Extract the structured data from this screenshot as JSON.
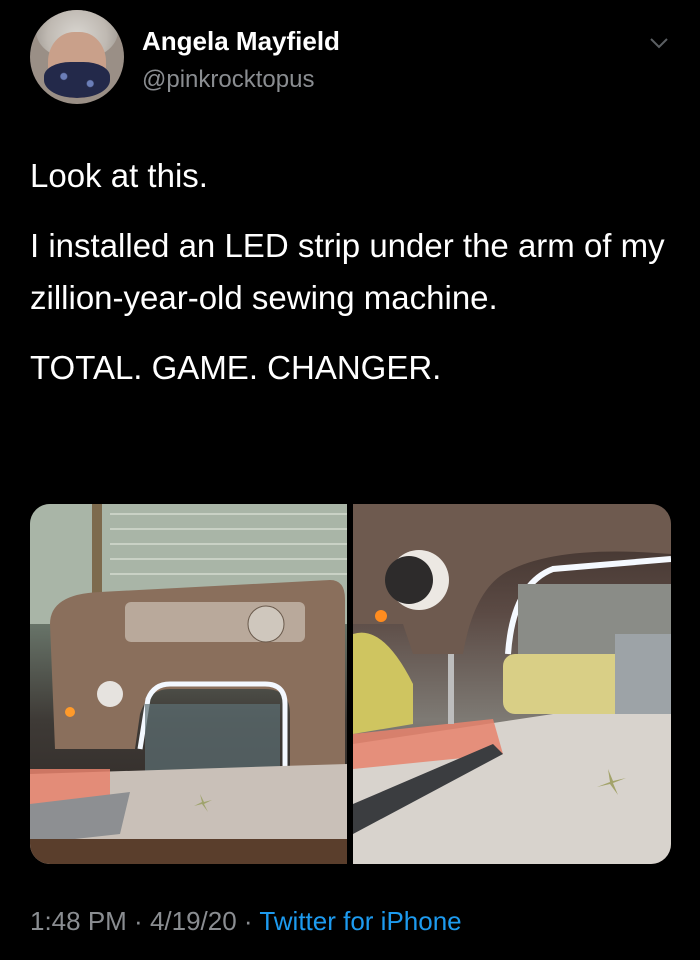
{
  "user": {
    "display_name": "Angela Mayfield",
    "handle": "@pinkrocktopus",
    "avatar_icon": "avatar-photo"
  },
  "tweet": {
    "paragraphs": [
      "Look at this.",
      "I installed an LED strip under the arm of my zillion-year-old sewing machine.",
      "TOTAL. GAME. CHANGER."
    ]
  },
  "media": {
    "photos": [
      {
        "icon": "sewing-machine-photo-front"
      },
      {
        "icon": "sewing-machine-photo-closeup"
      }
    ]
  },
  "footer": {
    "time": "1:48 PM",
    "separator": " · ",
    "date": "4/19/20",
    "source": "Twitter for iPhone"
  },
  "colors": {
    "background": "#000000",
    "secondary_text": "#8a8d91",
    "link": "#1d9bf0"
  }
}
